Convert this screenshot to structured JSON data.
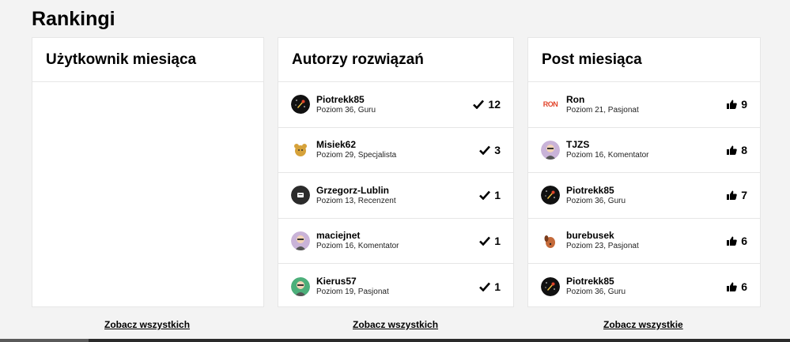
{
  "page": {
    "title": "Rankingi"
  },
  "columns": [
    {
      "title": "Użytkownik miesiąca",
      "rows": [],
      "see_all": "Zobacz wszystkich"
    },
    {
      "title": "Autorzy rozwiązań",
      "score_icon": "checkmark-icon",
      "see_all": "Zobacz wszystkich",
      "rows": [
        {
          "name": "Piotrekk85",
          "meta": "Poziom 36, Guru",
          "score": "12",
          "avatar": "rocket-avatar-icon",
          "avatar_color": "#111111"
        },
        {
          "name": "Misiek62",
          "meta": "Poziom 29, Specjalista",
          "score": "3",
          "avatar": "bear-avatar-icon",
          "avatar_color": "#d6a23a"
        },
        {
          "name": "Grzegorz-Lublin",
          "meta": "Poziom 13, Recenzent",
          "score": "1",
          "avatar": "badge-avatar-icon",
          "avatar_color": "#2b2b2b"
        },
        {
          "name": "maciejnet",
          "meta": "Poziom 16, Komentator",
          "score": "1",
          "avatar": "person-avatar-icon",
          "avatar_color": "#c9b3d8"
        },
        {
          "name": "Kierus57",
          "meta": "Poziom 19, Pasjonat",
          "score": "1",
          "avatar": "person-avatar-icon",
          "avatar_color": "#4caf7a"
        }
      ]
    },
    {
      "title": "Post miesiąca",
      "score_icon": "thumbs-up-icon",
      "see_all": "Zobacz wszystkie",
      "rows": [
        {
          "name": "Ron",
          "meta": "Poziom 21, Pasjonat",
          "score": "9",
          "avatar": "ron-logo-icon",
          "avatar_color": "#ffffff",
          "logo_text": "RON"
        },
        {
          "name": "TJZS",
          "meta": "Poziom 16, Komentator",
          "score": "8",
          "avatar": "person-avatar-icon",
          "avatar_color": "#c9b3d8"
        },
        {
          "name": "Piotrekk85",
          "meta": "Poziom 36, Guru",
          "score": "7",
          "avatar": "rocket-avatar-icon",
          "avatar_color": "#111111"
        },
        {
          "name": "burebusek",
          "meta": "Poziom 23, Pasjonat",
          "score": "6",
          "avatar": "dog-avatar-icon",
          "avatar_color": "#c46a3a"
        },
        {
          "name": "Piotrekk85",
          "meta": "Poziom 36, Guru",
          "score": "6",
          "avatar": "rocket-avatar-icon",
          "avatar_color": "#111111"
        }
      ]
    }
  ],
  "colors": {
    "background": "#f3f3f3",
    "card": "#ffffff",
    "border": "#e6e6e6",
    "ron_logo": "#e2452b"
  }
}
